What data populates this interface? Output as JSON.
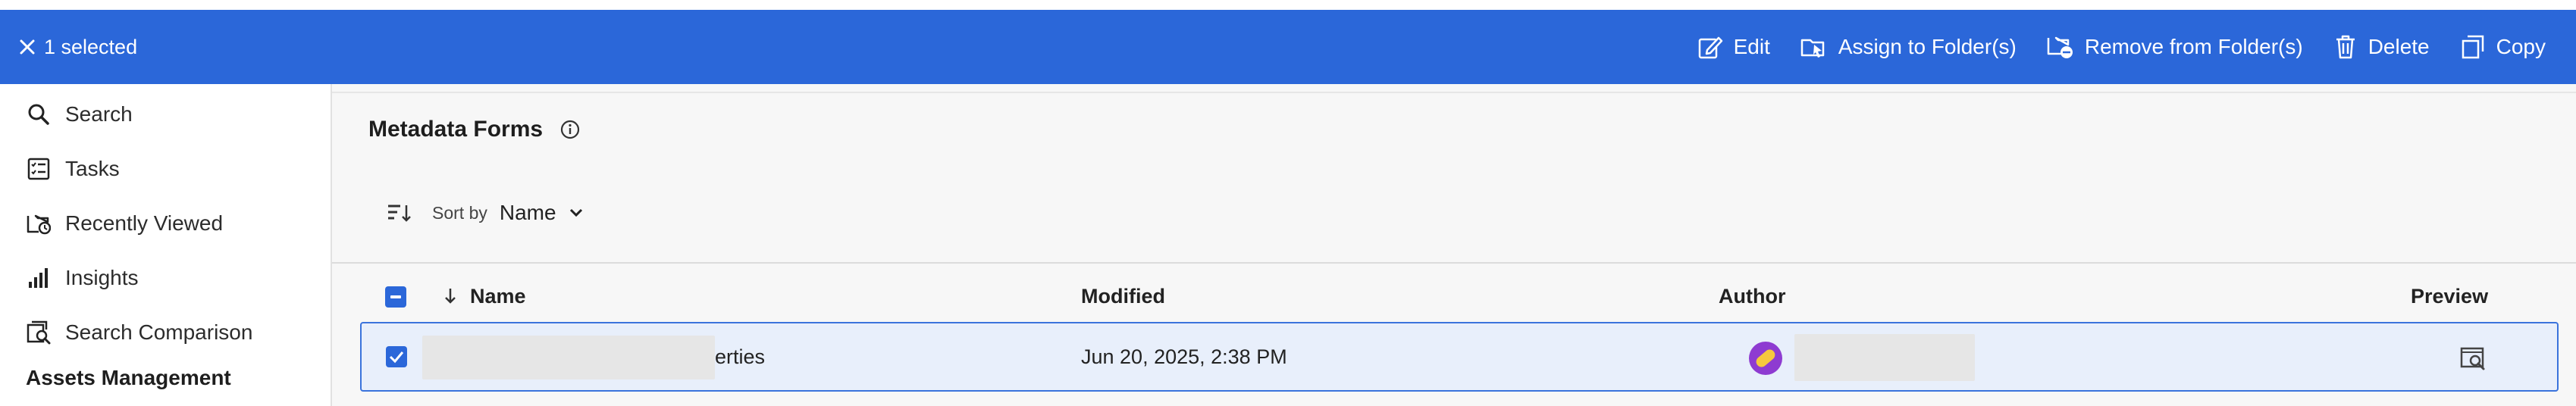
{
  "action_bar": {
    "selection_label": "1 selected",
    "actions": [
      {
        "label": "Edit",
        "icon": "edit-icon"
      },
      {
        "label": "Assign to Folder(s)",
        "icon": "assign-folder-icon"
      },
      {
        "label": "Remove from Folder(s)",
        "icon": "remove-folder-icon"
      },
      {
        "label": "Delete",
        "icon": "trash-icon"
      },
      {
        "label": "Copy",
        "icon": "copy-icon"
      }
    ],
    "background_color": "#2b67d9"
  },
  "sidebar": {
    "items": [
      {
        "label": "Search",
        "icon": "search-icon"
      },
      {
        "label": "Tasks",
        "icon": "tasks-icon"
      },
      {
        "label": "Recently Viewed",
        "icon": "recently-viewed-icon"
      },
      {
        "label": "Insights",
        "icon": "insights-icon"
      },
      {
        "label": "Search Comparison",
        "icon": "search-comparison-icon"
      }
    ],
    "section_heading": "Assets Management"
  },
  "main": {
    "title": "Metadata Forms",
    "sort": {
      "label": "Sort by",
      "value": "Name"
    },
    "columns": [
      "Name",
      "Modified",
      "Author",
      "Preview"
    ],
    "rows": [
      {
        "selected": true,
        "name_visible_fragment": "erties",
        "modified": "Jun 20, 2025, 2:38 PM"
      }
    ]
  }
}
